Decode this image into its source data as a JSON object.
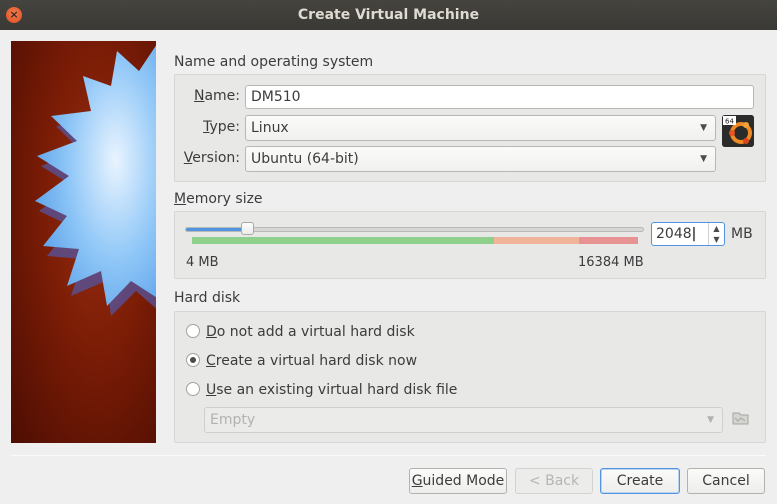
{
  "window": {
    "title": "Create Virtual Machine",
    "close_glyph": "×"
  },
  "name_os": {
    "group_title": "Name and operating system",
    "name_label_u": "N",
    "name_label_rest": "ame:",
    "name_value": "DM510",
    "type_label_u": "T",
    "type_label_rest": "ype:",
    "type_value": "Linux",
    "version_label_u": "V",
    "version_label_rest": "ersion:",
    "version_value": "Ubuntu (64-bit)",
    "os_icon": "ubuntu-64-icon",
    "os_icon_badge": "64"
  },
  "memory": {
    "group_title_u": "M",
    "group_title_rest": "emory size",
    "min_label": "4 MB",
    "max_label": "16384 MB",
    "value": "2048",
    "unit": "MB",
    "slider_fraction": 0.125,
    "scale_colors": {
      "green": "#8fd18c",
      "orange": "#f0b49a",
      "red": "#e79393"
    }
  },
  "hard_disk": {
    "group_title": "Hard disk",
    "options": [
      {
        "u": "D",
        "rest": "o not add a virtual hard disk",
        "selected": false
      },
      {
        "u": "C",
        "rest": "reate a virtual hard disk now",
        "selected": true
      },
      {
        "u": "U",
        "rest": "se an existing virtual hard disk file",
        "selected": false
      }
    ],
    "existing_file_value": "Empty"
  },
  "buttons": {
    "guided_mode_u": "G",
    "guided_mode_rest": "uided Mode",
    "back": "< Back",
    "create": "Create",
    "cancel": "Cancel"
  },
  "colors": {
    "accent": "#5294e2",
    "titlebar": "#3d3c38"
  }
}
